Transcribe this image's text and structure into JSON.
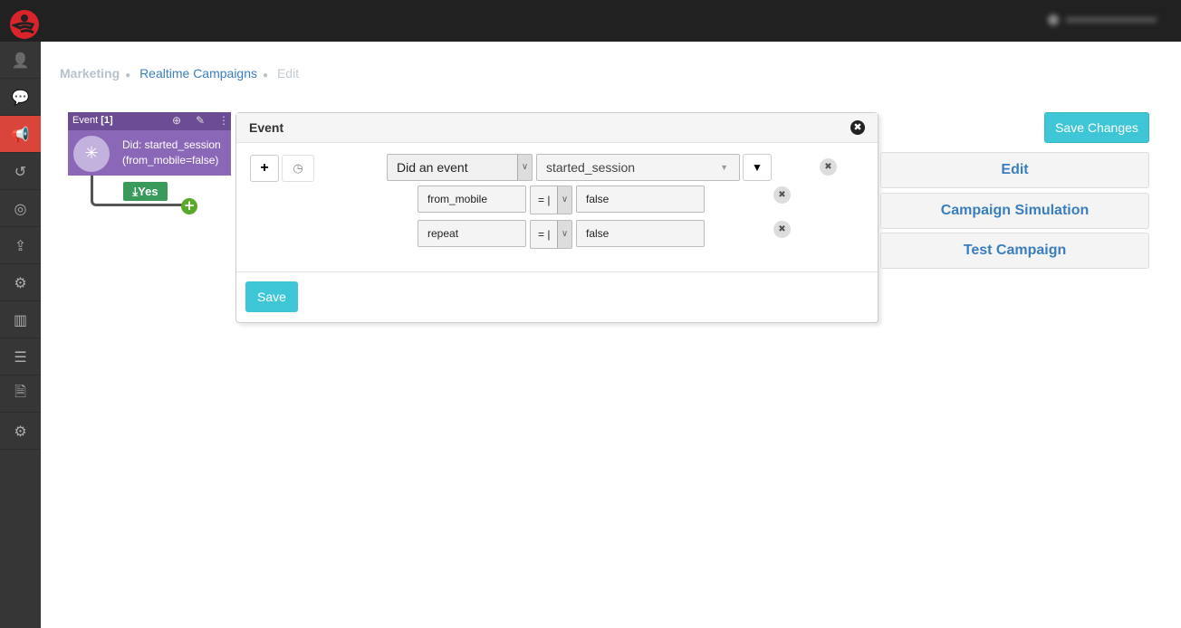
{
  "brand": {
    "accent": "#d9453a",
    "primary": "#3fc6d6",
    "node_color": "#8b67b8"
  },
  "sidebar": {
    "items": [
      {
        "icon": "user-icon",
        "glyph": "👤"
      },
      {
        "icon": "chat-icon",
        "glyph": "💬"
      },
      {
        "icon": "megaphone-icon",
        "glyph": "📢",
        "active": true
      },
      {
        "icon": "history-icon",
        "glyph": "↺"
      },
      {
        "icon": "target-icon",
        "glyph": "◎"
      },
      {
        "icon": "upload-icon",
        "glyph": "⇪"
      },
      {
        "icon": "gears-icon",
        "glyph": "⚙"
      },
      {
        "icon": "bar-chart-icon",
        "glyph": "▥"
      },
      {
        "icon": "list-icon",
        "glyph": "☰"
      },
      {
        "icon": "file-code-icon",
        "glyph": "🗎"
      },
      {
        "icon": "gears-icon",
        "glyph": "⚙"
      }
    ]
  },
  "breadcrumb": {
    "items": [
      "Marketing",
      "Realtime Campaigns",
      "Edit"
    ]
  },
  "node": {
    "title": "Event",
    "count": "[1]",
    "line1": "Did: started_session",
    "line2": "(from_mobile=false)",
    "yes_label": "Yes"
  },
  "modal": {
    "title": "Event",
    "event_type": "Did an event",
    "event_name": "started_session",
    "conditions": [
      {
        "field": "from_mobile",
        "operator": "= |",
        "value": "false"
      },
      {
        "field": "repeat",
        "operator": "= |",
        "value": "false"
      }
    ],
    "save_label": "Save"
  },
  "actions": {
    "save_changes": "Save Changes",
    "edit": "Edit",
    "simulation": "Campaign Simulation",
    "test": "Test Campaign"
  }
}
